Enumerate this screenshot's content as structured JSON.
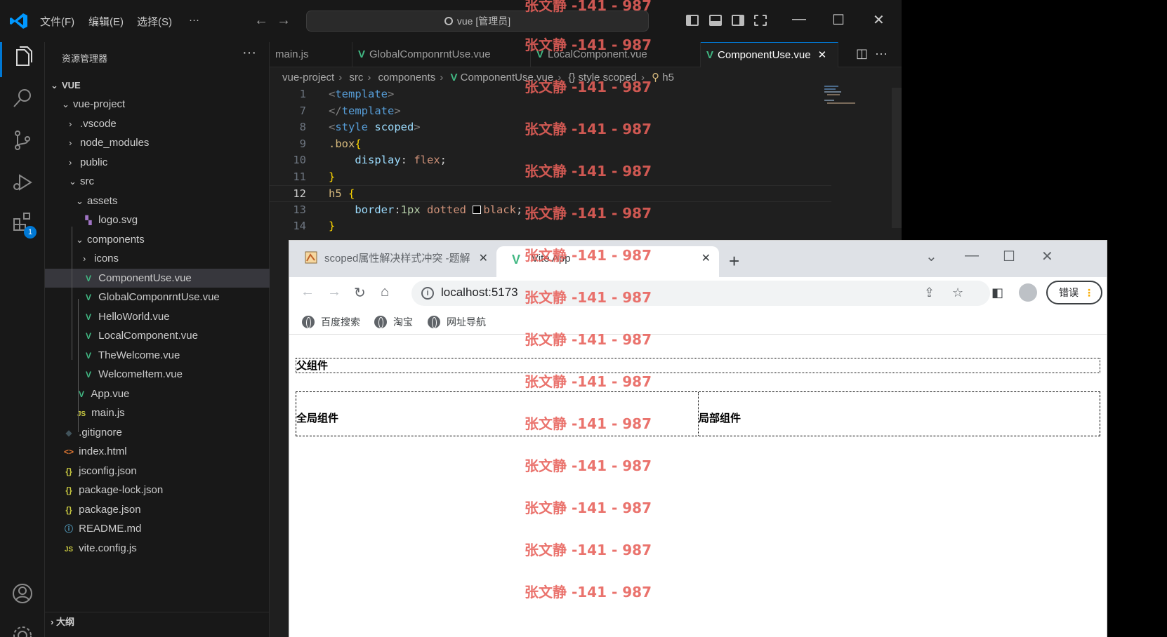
{
  "vscode": {
    "menu": [
      "文件(F)",
      "编辑(E)",
      "选择(S)",
      "···"
    ],
    "search_text": "vue [管理员]",
    "sidebar": {
      "title": "资源管理器",
      "root": "VUE",
      "tree": [
        {
          "label": "vue-project",
          "chev": "⌄",
          "icon": "",
          "cls": ""
        },
        {
          "label": ".vscode",
          "chev": "›",
          "icon": "",
          "cls": ""
        },
        {
          "label": "node_modules",
          "chev": "›",
          "icon": "",
          "cls": ""
        },
        {
          "label": "public",
          "chev": "›",
          "icon": "",
          "cls": ""
        },
        {
          "label": "src",
          "chev": "⌄",
          "icon": "",
          "cls": ""
        },
        {
          "label": "assets",
          "chev": "⌄",
          "icon": "",
          "cls": ""
        },
        {
          "label": "logo.svg",
          "chev": "",
          "icon": "▚",
          "cls": "svg-ico"
        },
        {
          "label": "components",
          "chev": "⌄",
          "icon": "",
          "cls": ""
        },
        {
          "label": "icons",
          "chev": "›",
          "icon": "",
          "cls": ""
        },
        {
          "label": "ComponentUse.vue",
          "chev": "",
          "icon": "V",
          "cls": "vue-ico"
        },
        {
          "label": "GlobalComponrntUse.vue",
          "chev": "",
          "icon": "V",
          "cls": "vue-ico"
        },
        {
          "label": "HelloWorld.vue",
          "chev": "",
          "icon": "V",
          "cls": "vue-ico"
        },
        {
          "label": "LocalComponent.vue",
          "chev": "",
          "icon": "V",
          "cls": "vue-ico"
        },
        {
          "label": "TheWelcome.vue",
          "chev": "",
          "icon": "V",
          "cls": "vue-ico"
        },
        {
          "label": "WelcomeItem.vue",
          "chev": "",
          "icon": "V",
          "cls": "vue-ico"
        },
        {
          "label": "App.vue",
          "chev": "",
          "icon": "V",
          "cls": "vue-ico"
        },
        {
          "label": "main.js",
          "chev": "",
          "icon": "JS",
          "cls": "js-ico"
        },
        {
          "label": ".gitignore",
          "chev": "",
          "icon": "◆",
          "cls": "git-ico"
        },
        {
          "label": "index.html",
          "chev": "",
          "icon": "<>",
          "cls": "html-ico"
        },
        {
          "label": "jsconfig.json",
          "chev": "",
          "icon": "{}",
          "cls": "json-ico"
        },
        {
          "label": "package-lock.json",
          "chev": "",
          "icon": "{}",
          "cls": "json-ico"
        },
        {
          "label": "package.json",
          "chev": "",
          "icon": "{}",
          "cls": "json-ico"
        },
        {
          "label": "README.md",
          "chev": "",
          "icon": "ⓘ",
          "cls": "info-ico"
        },
        {
          "label": "vite.config.js",
          "chev": "",
          "icon": "JS",
          "cls": "js-ico"
        }
      ],
      "outline": "大纲"
    },
    "tabs": [
      "main.js",
      "GlobalComponrntUse.vue",
      "LocalComponent.vue",
      "ComponentUse.vue"
    ],
    "breadcrumb": [
      "vue-project",
      "src",
      "components",
      "ComponentUse.vue",
      "{} style scoped",
      "h5"
    ],
    "badge": "1",
    "code_lines": [
      {
        "n": "1",
        "html": "<span class='t-punct'>&lt;</span><span class='t-tag'>template</span><span class='t-punct'>&gt;</span>"
      },
      {
        "n": "7",
        "html": "<span class='t-punct'>&lt;/</span><span class='t-tag'>template</span><span class='t-punct'>&gt;</span>"
      },
      {
        "n": "8",
        "html": "<span class='t-punct'>&lt;</span><span class='t-tag'>style</span> <span class='t-attr'>scoped</span><span class='t-punct'>&gt;</span>"
      },
      {
        "n": "9",
        "html": "<span class='t-sel'>.box</span><span class='t-brace'>{</span>"
      },
      {
        "n": "10",
        "html": "    <span class='t-prop'>display</span><span class='t-plain'>: </span><span class='t-val'>flex</span><span class='t-plain'>;</span>"
      },
      {
        "n": "11",
        "html": "<span class='t-brace'>}</span>"
      },
      {
        "n": "12",
        "html": "<span class='t-sel'>h5</span> <span class='t-brace'>{</span>"
      },
      {
        "n": "13",
        "html": "    <span class='t-prop'>border</span><span class='t-plain'>:</span><span class='t-num'>1px</span> <span class='t-val'>dotted</span> <span class='swatch'></span><span class='t-val'>black</span><span class='t-plain'>;</span>"
      },
      {
        "n": "14",
        "html": "<span class='t-brace'>}</span>"
      }
    ]
  },
  "chrome": {
    "tabs": [
      {
        "title": "scoped属性解决样式冲突 -题解"
      },
      {
        "title": "Vite App"
      }
    ],
    "url": "localhost:5173",
    "error_label": "错误",
    "bookmarks": [
      "百度搜索",
      "淘宝",
      "网址导航"
    ],
    "page": {
      "parent_heading": "父组件",
      "global_heading": "全局组件",
      "local_heading": "局部组件"
    }
  },
  "watermark": "张文静 -141 - 987",
  "colors": {
    "accent": "#0078d4",
    "vue_green": "#41b883",
    "watermark": "#e8605a"
  }
}
